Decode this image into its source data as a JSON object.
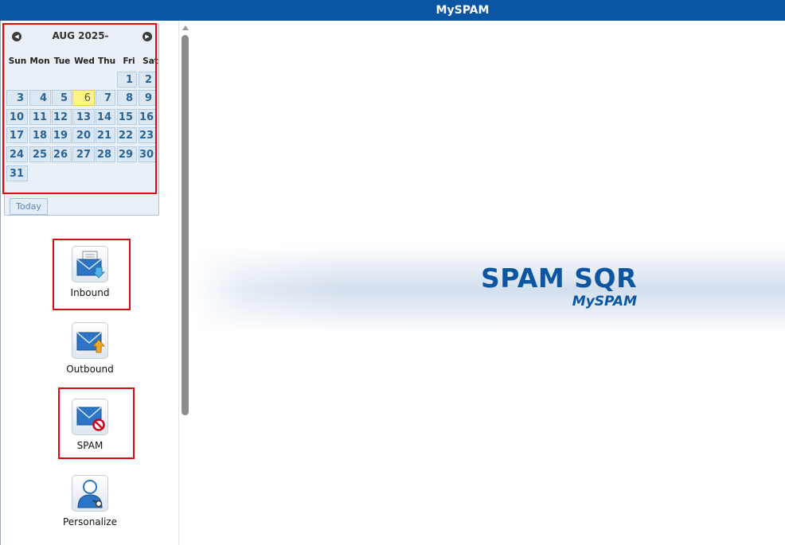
{
  "app": {
    "title": "MySPAM"
  },
  "calendar": {
    "month_label": "AUG 2025-",
    "prev_icon": "chevron-left-circle-icon",
    "next_icon": "chevron-right-circle-icon",
    "weekdays": [
      "Sun",
      "Mon",
      "Tue",
      "Wed",
      "Thu",
      "Fri",
      "Sat"
    ],
    "weeks": [
      [
        "",
        "",
        "",
        "",
        "",
        "1",
        "2"
      ],
      [
        "3",
        "4",
        "5",
        "6",
        "7",
        "8",
        "9"
      ],
      [
        "10",
        "11",
        "12",
        "13",
        "14",
        "15",
        "16"
      ],
      [
        "17",
        "18",
        "19",
        "20",
        "21",
        "22",
        "23"
      ],
      [
        "24",
        "25",
        "26",
        "27",
        "28",
        "29",
        "30"
      ],
      [
        "31",
        "",
        "",
        "",
        "",
        "",
        ""
      ]
    ],
    "selected_day": "6",
    "today_label": "Today",
    "colors": {
      "cell": "#dbe8f4",
      "today_highlight": "#fdf58c",
      "day_text": "#2a6496"
    }
  },
  "menu": {
    "items": [
      {
        "label": "Inbound",
        "icon": "inbound-mail-icon"
      },
      {
        "label": "Outbound",
        "icon": "outbound-mail-icon"
      },
      {
        "label": "SPAM",
        "icon": "spam-mail-icon"
      },
      {
        "label": "Personalize",
        "icon": "user-settings-icon"
      }
    ]
  },
  "banner": {
    "title": "SPAM SQR",
    "subtitle": "MySPAM"
  },
  "colors": {
    "header": "#0b56a4",
    "brand": "#0c56a1",
    "highlight_box": "#d90d0d"
  }
}
